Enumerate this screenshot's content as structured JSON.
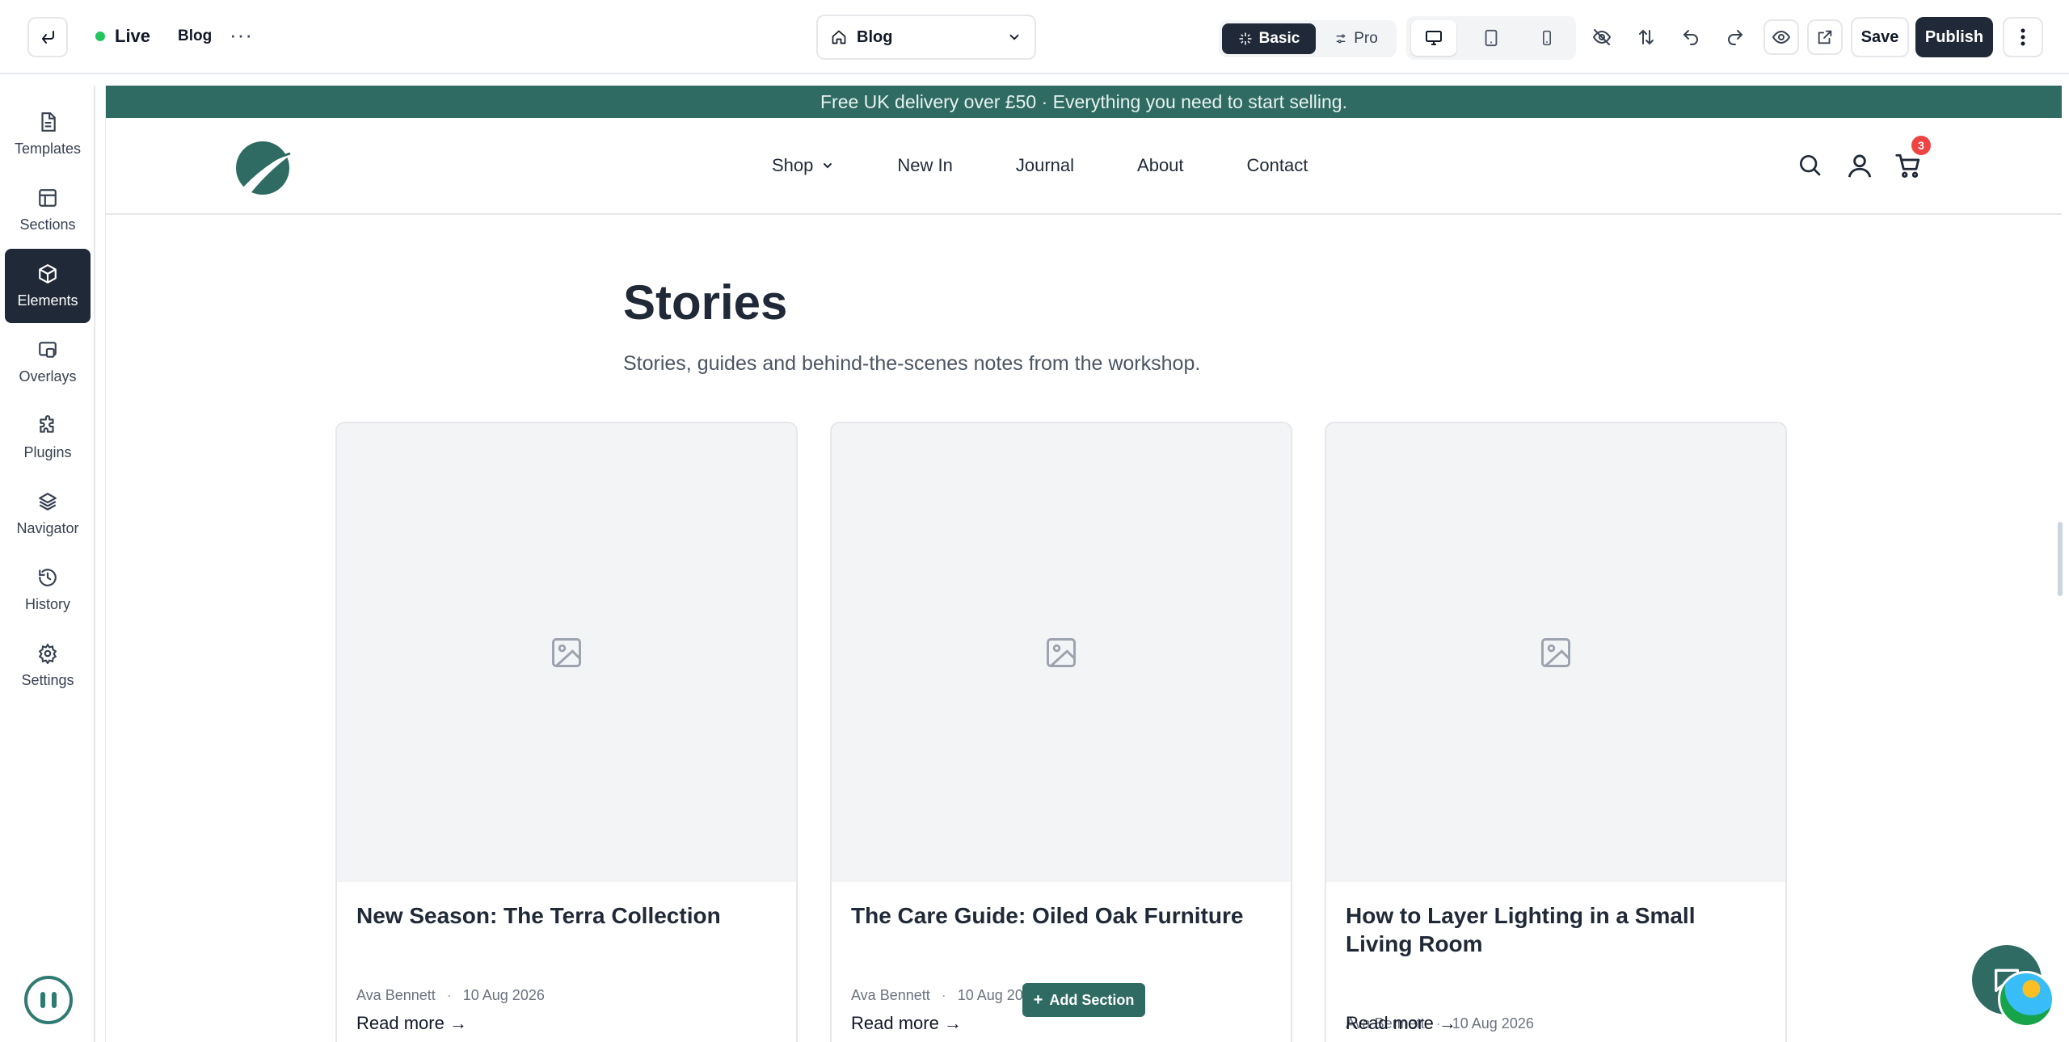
{
  "topbar": {
    "status": "Live",
    "page_name": "Blog",
    "page_selector": "Blog",
    "mode_basic": "Basic",
    "mode_pro": "Pro",
    "save": "Save",
    "publish": "Publish"
  },
  "sidebar": {
    "items": [
      {
        "label": "Templates",
        "icon": "templates-icon"
      },
      {
        "label": "Sections",
        "icon": "sections-icon"
      },
      {
        "label": "Elements",
        "icon": "elements-icon"
      },
      {
        "label": "Overlays",
        "icon": "overlays-icon"
      },
      {
        "label": "Plugins",
        "icon": "plugins-icon"
      },
      {
        "label": "Navigator",
        "icon": "navigator-icon"
      },
      {
        "label": "History",
        "icon": "history-icon"
      },
      {
        "label": "Settings",
        "icon": "settings-icon"
      }
    ],
    "active": "Elements"
  },
  "site": {
    "promo": "Free UK delivery over £50 · Everything you need to start selling.",
    "nav": [
      "Shop",
      "New In",
      "Journal",
      "About",
      "Contact"
    ],
    "cart_count": "3",
    "title": "Stories",
    "subtitle": "Stories, guides and behind-the-scenes notes from the workshop.",
    "posts": [
      {
        "title": "New Season: The Terra Collection",
        "author": "Ava Bennett",
        "date": "10 Aug 2026",
        "link": "Read more →"
      },
      {
        "title": "The Care Guide: Oiled Oak Furniture",
        "author": "Ava Bennett",
        "date": "10 Aug 2026",
        "link": "Read more →"
      },
      {
        "title": "How to Layer Lighting in a Small Living Room",
        "author": "Ava Bennett",
        "date": "10 Aug 2026",
        "link": "Read more →"
      }
    ]
  },
  "add_section": "Add Section",
  "colors": {
    "brand": "#2f6b62",
    "dark": "#1f2937",
    "live": "#22c55e",
    "badge": "#ef4444"
  }
}
